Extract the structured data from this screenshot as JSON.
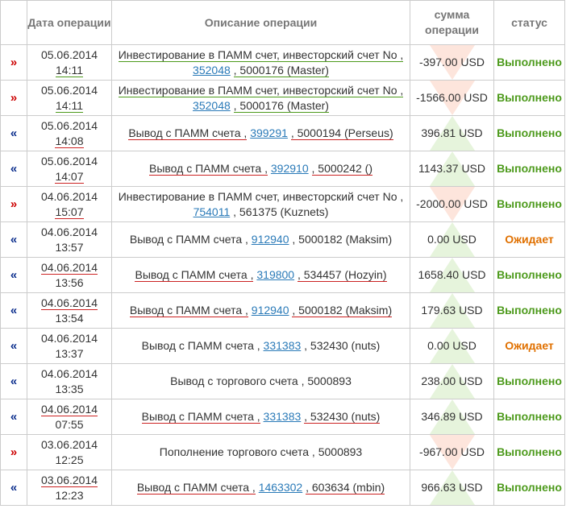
{
  "headers": {
    "date": "Дата операции",
    "description": "Описание операции",
    "amount": "сумма операции",
    "status": "статус"
  },
  "colors": {
    "arrow_out": "#cc0000",
    "arrow_in": "#0a2d8c",
    "status_done": "#4d9a1c",
    "status_wait": "#e07000",
    "link": "#2a7ab8"
  },
  "rows": [
    {
      "dir": "out",
      "arrow": "»",
      "date": "05.06.2014",
      "time": "14:11",
      "text": "Инвестирование в ПАММ счет, инвесторский счет No ,",
      "link": "352048",
      "rest": ", 5000176 (Master)",
      "amount": "-397.00 USD",
      "status": "Выполнено"
    },
    {
      "dir": "out",
      "arrow": "»",
      "date": "05.06.2014",
      "time": "14:11",
      "text": "Инвестирование в ПАММ счет, инвесторский счет No ,",
      "link": "352048",
      "rest": ", 5000176 (Master)",
      "amount": "-1566.00 USD",
      "status": "Выполнено"
    },
    {
      "dir": "in",
      "arrow": "«",
      "date": "05.06.2014",
      "time": "14:08",
      "text": "Вывод с ПАММ счета ,",
      "link": "399291",
      "rest": ", 5000194 (Perseus)",
      "amount": "396.81 USD",
      "status": "Выполнено"
    },
    {
      "dir": "in",
      "arrow": "«",
      "date": "05.06.2014",
      "time": "14:07",
      "text": "Вывод с ПАММ счета ,",
      "link": "392910",
      "rest": ", 5000242 ()",
      "amount": "1143.37 USD",
      "status": "Выполнено"
    },
    {
      "dir": "out",
      "arrow": "»",
      "date": "04.06.2014",
      "time": "15:07",
      "text": "Инвестирование в ПАММ счет, инвесторский счет No ,",
      "link": "754011",
      "rest": ", 561375 (Kuznets)",
      "amount": "-2000.00 USD",
      "status": "Выполнено"
    },
    {
      "dir": "in",
      "arrow": "«",
      "date": "04.06.2014",
      "time": "13:57",
      "text": "Вывод с ПАММ счета ,",
      "link": "912940",
      "rest": ", 5000182 (Maksim)",
      "amount": "0.00 USD",
      "status": "Ожидает"
    },
    {
      "dir": "in",
      "arrow": "«",
      "date": "04.06.2014",
      "time": "13:56",
      "text": "Вывод с ПАММ счета ,",
      "link": "319800",
      "rest": ", 534457 (Hozyin)",
      "amount": "1658.40 USD",
      "status": "Выполнено"
    },
    {
      "dir": "in",
      "arrow": "«",
      "date": "04.06.2014",
      "time": "13:54",
      "text": "Вывод с ПАММ счета ,",
      "link": "912940",
      "rest": ", 5000182 (Maksim)",
      "amount": "179.63 USD",
      "status": "Выполнено"
    },
    {
      "dir": "in",
      "arrow": "«",
      "date": "04.06.2014",
      "time": "13:37",
      "text": "Вывод с ПАММ счета ,",
      "link": "331383",
      "rest": ", 532430 (nuts)",
      "amount": "0.00 USD",
      "status": "Ожидает"
    },
    {
      "dir": "in",
      "arrow": "«",
      "date": "04.06.2014",
      "time": "13:35",
      "text": "Вывод с торгового счета , 5000893",
      "link": "",
      "rest": "",
      "amount": "238.00 USD",
      "status": "Выполнено"
    },
    {
      "dir": "in",
      "arrow": "«",
      "date": "04.06.2014",
      "time": "07:55",
      "text": "Вывод с ПАММ счета ,",
      "link": "331383",
      "rest": ", 532430 (nuts)",
      "amount": "346.89 USD",
      "status": "Выполнено"
    },
    {
      "dir": "out",
      "arrow": "»",
      "date": "03.06.2014",
      "time": "12:25",
      "text": "Пополнение торгового счета , 5000893",
      "link": "",
      "rest": "",
      "amount": "-967.00 USD",
      "status": "Выполнено"
    },
    {
      "dir": "in",
      "arrow": "«",
      "date": "03.06.2014",
      "time": "12:23",
      "text": "Вывод с ПАММ счета ,",
      "link": "1463302",
      "rest": ", 603634 (mbin)",
      "amount": "966.63 USD",
      "status": "Выполнено"
    }
  ]
}
